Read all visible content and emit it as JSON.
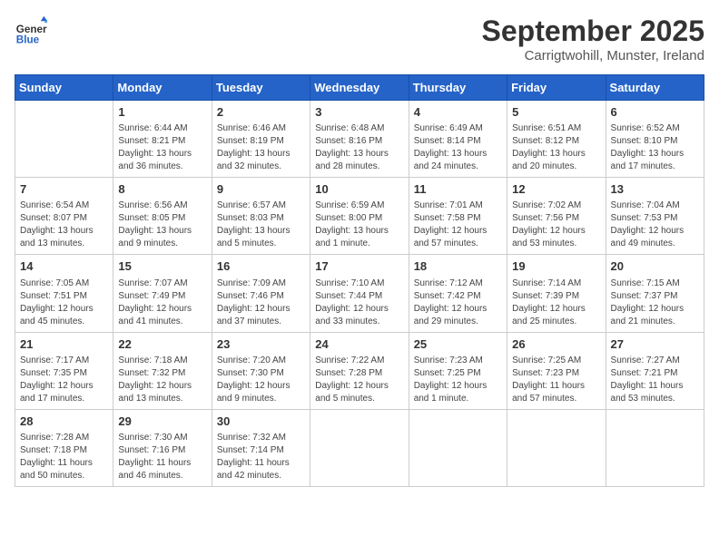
{
  "header": {
    "logo_general": "General",
    "logo_blue": "Blue",
    "title": "September 2025",
    "subtitle": "Carrigtwohill, Munster, Ireland"
  },
  "days_of_week": [
    "Sunday",
    "Monday",
    "Tuesday",
    "Wednesday",
    "Thursday",
    "Friday",
    "Saturday"
  ],
  "weeks": [
    [
      {
        "day": "",
        "info": ""
      },
      {
        "day": "1",
        "info": "Sunrise: 6:44 AM\nSunset: 8:21 PM\nDaylight: 13 hours\nand 36 minutes."
      },
      {
        "day": "2",
        "info": "Sunrise: 6:46 AM\nSunset: 8:19 PM\nDaylight: 13 hours\nand 32 minutes."
      },
      {
        "day": "3",
        "info": "Sunrise: 6:48 AM\nSunset: 8:16 PM\nDaylight: 13 hours\nand 28 minutes."
      },
      {
        "day": "4",
        "info": "Sunrise: 6:49 AM\nSunset: 8:14 PM\nDaylight: 13 hours\nand 24 minutes."
      },
      {
        "day": "5",
        "info": "Sunrise: 6:51 AM\nSunset: 8:12 PM\nDaylight: 13 hours\nand 20 minutes."
      },
      {
        "day": "6",
        "info": "Sunrise: 6:52 AM\nSunset: 8:10 PM\nDaylight: 13 hours\nand 17 minutes."
      }
    ],
    [
      {
        "day": "7",
        "info": "Sunrise: 6:54 AM\nSunset: 8:07 PM\nDaylight: 13 hours\nand 13 minutes."
      },
      {
        "day": "8",
        "info": "Sunrise: 6:56 AM\nSunset: 8:05 PM\nDaylight: 13 hours\nand 9 minutes."
      },
      {
        "day": "9",
        "info": "Sunrise: 6:57 AM\nSunset: 8:03 PM\nDaylight: 13 hours\nand 5 minutes."
      },
      {
        "day": "10",
        "info": "Sunrise: 6:59 AM\nSunset: 8:00 PM\nDaylight: 13 hours\nand 1 minute."
      },
      {
        "day": "11",
        "info": "Sunrise: 7:01 AM\nSunset: 7:58 PM\nDaylight: 12 hours\nand 57 minutes."
      },
      {
        "day": "12",
        "info": "Sunrise: 7:02 AM\nSunset: 7:56 PM\nDaylight: 12 hours\nand 53 minutes."
      },
      {
        "day": "13",
        "info": "Sunrise: 7:04 AM\nSunset: 7:53 PM\nDaylight: 12 hours\nand 49 minutes."
      }
    ],
    [
      {
        "day": "14",
        "info": "Sunrise: 7:05 AM\nSunset: 7:51 PM\nDaylight: 12 hours\nand 45 minutes."
      },
      {
        "day": "15",
        "info": "Sunrise: 7:07 AM\nSunset: 7:49 PM\nDaylight: 12 hours\nand 41 minutes."
      },
      {
        "day": "16",
        "info": "Sunrise: 7:09 AM\nSunset: 7:46 PM\nDaylight: 12 hours\nand 37 minutes."
      },
      {
        "day": "17",
        "info": "Sunrise: 7:10 AM\nSunset: 7:44 PM\nDaylight: 12 hours\nand 33 minutes."
      },
      {
        "day": "18",
        "info": "Sunrise: 7:12 AM\nSunset: 7:42 PM\nDaylight: 12 hours\nand 29 minutes."
      },
      {
        "day": "19",
        "info": "Sunrise: 7:14 AM\nSunset: 7:39 PM\nDaylight: 12 hours\nand 25 minutes."
      },
      {
        "day": "20",
        "info": "Sunrise: 7:15 AM\nSunset: 7:37 PM\nDaylight: 12 hours\nand 21 minutes."
      }
    ],
    [
      {
        "day": "21",
        "info": "Sunrise: 7:17 AM\nSunset: 7:35 PM\nDaylight: 12 hours\nand 17 minutes."
      },
      {
        "day": "22",
        "info": "Sunrise: 7:18 AM\nSunset: 7:32 PM\nDaylight: 12 hours\nand 13 minutes."
      },
      {
        "day": "23",
        "info": "Sunrise: 7:20 AM\nSunset: 7:30 PM\nDaylight: 12 hours\nand 9 minutes."
      },
      {
        "day": "24",
        "info": "Sunrise: 7:22 AM\nSunset: 7:28 PM\nDaylight: 12 hours\nand 5 minutes."
      },
      {
        "day": "25",
        "info": "Sunrise: 7:23 AM\nSunset: 7:25 PM\nDaylight: 12 hours\nand 1 minute."
      },
      {
        "day": "26",
        "info": "Sunrise: 7:25 AM\nSunset: 7:23 PM\nDaylight: 11 hours\nand 57 minutes."
      },
      {
        "day": "27",
        "info": "Sunrise: 7:27 AM\nSunset: 7:21 PM\nDaylight: 11 hours\nand 53 minutes."
      }
    ],
    [
      {
        "day": "28",
        "info": "Sunrise: 7:28 AM\nSunset: 7:18 PM\nDaylight: 11 hours\nand 50 minutes."
      },
      {
        "day": "29",
        "info": "Sunrise: 7:30 AM\nSunset: 7:16 PM\nDaylight: 11 hours\nand 46 minutes."
      },
      {
        "day": "30",
        "info": "Sunrise: 7:32 AM\nSunset: 7:14 PM\nDaylight: 11 hours\nand 42 minutes."
      },
      {
        "day": "",
        "info": ""
      },
      {
        "day": "",
        "info": ""
      },
      {
        "day": "",
        "info": ""
      },
      {
        "day": "",
        "info": ""
      }
    ]
  ]
}
